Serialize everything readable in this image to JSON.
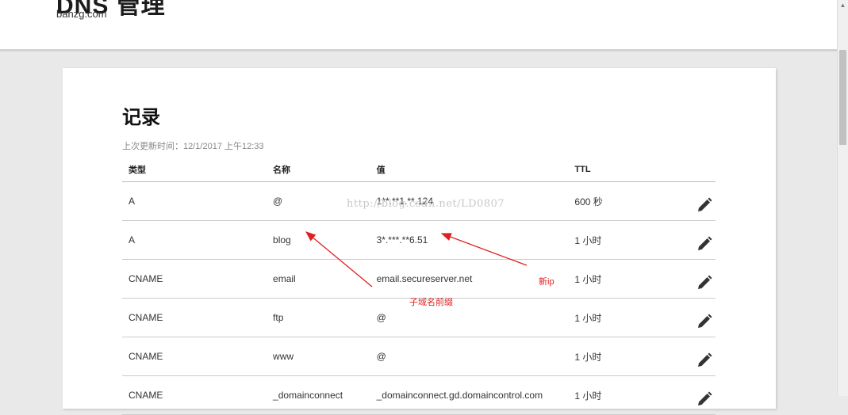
{
  "header": {
    "title": "DNS 管理",
    "domain": "banzg.com"
  },
  "records": {
    "title": "记录",
    "last_updated": "上次更新时间：12/1/2017 上午12:33",
    "columns": [
      "类型",
      "名称",
      "值",
      "TTL"
    ],
    "rows": [
      {
        "type": "A",
        "name": "@",
        "value": "1**.**1.**.124",
        "ttl": "600 秒"
      },
      {
        "type": "A",
        "name": "blog",
        "value": "3*.***.**6.51",
        "ttl": "1 小时"
      },
      {
        "type": "CNAME",
        "name": "email",
        "value": "email.secureserver.net",
        "ttl": "1 小时"
      },
      {
        "type": "CNAME",
        "name": "ftp",
        "value": "@",
        "ttl": "1 小时"
      },
      {
        "type": "CNAME",
        "name": "www",
        "value": "@",
        "ttl": "1 小时"
      },
      {
        "type": "CNAME",
        "name": "_domainconnect",
        "value": "_domainconnect.gd.domaincontrol.com",
        "ttl": "1 小时"
      }
    ]
  },
  "watermark": "http://blog.csdn.net/LD0807",
  "annotations": {
    "new_ip": "新ip",
    "subdomain_prefix": "子域名前缀",
    "color": "#e02020"
  },
  "icons": {
    "edit": "pencil-icon"
  }
}
